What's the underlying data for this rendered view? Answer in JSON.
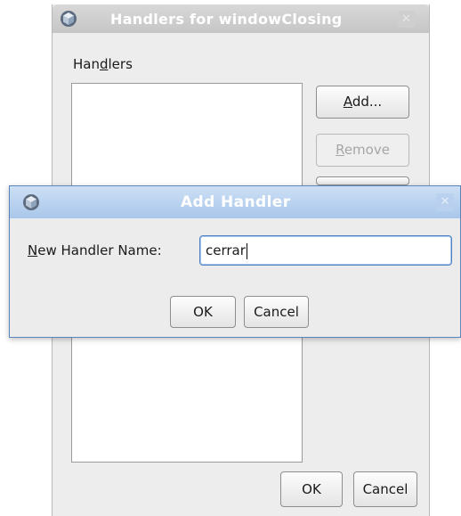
{
  "background_dialog": {
    "title": "Handlers for windowClosing",
    "list_label": "Handlers",
    "add_label": "Add...",
    "remove_label": "Remove",
    "ok_label": "OK",
    "cancel_label": "Cancel",
    "close_icon": "close-icon",
    "title_icon": "cube-icon"
  },
  "add_handler_dialog": {
    "title": "Add Handler",
    "field_label": "New Handler Name:",
    "field_value": "cerrar",
    "ok_label": "OK",
    "cancel_label": "Cancel",
    "close_icon": "close-icon",
    "title_icon": "cube-icon",
    "accent_color": "#4b82c6"
  }
}
